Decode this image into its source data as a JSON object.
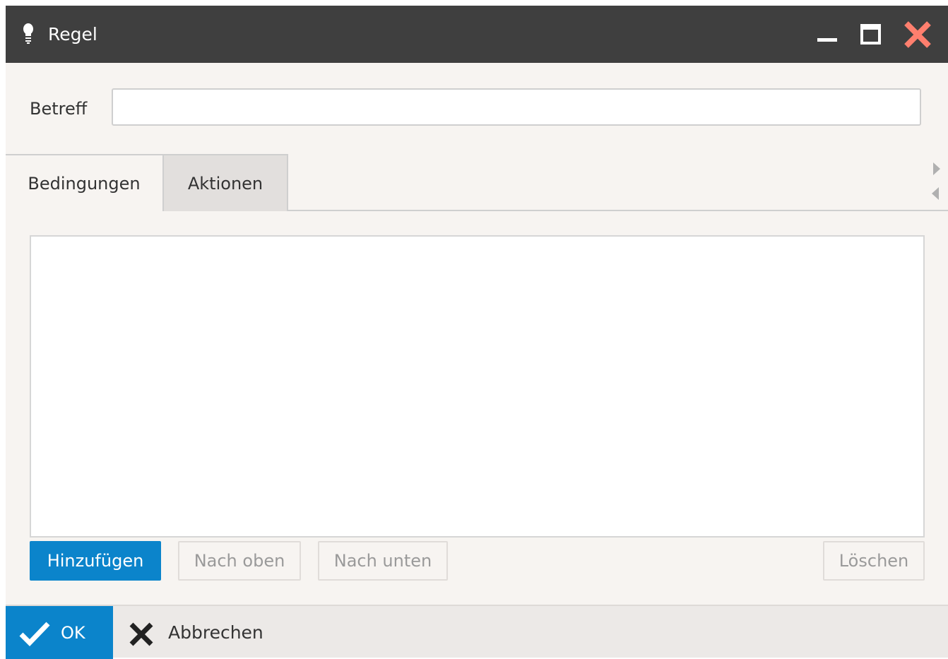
{
  "window": {
    "title": "Regel",
    "icon": "lightbulb-icon",
    "controls": [
      "minimize-icon",
      "maximize-icon",
      "close-icon"
    ],
    "close_color": "#ff7f6e"
  },
  "form": {
    "subject_label": "Betreff",
    "subject_value": ""
  },
  "tabs": [
    {
      "label": "Bedingungen",
      "active": true
    },
    {
      "label": "Aktionen",
      "active": false
    }
  ],
  "list": {
    "items": []
  },
  "list_actions": {
    "add_label": "Hinzufügen",
    "up_label": "Nach oben",
    "down_label": "Nach unten",
    "delete_label": "Löschen"
  },
  "footer": {
    "ok_label": "OK",
    "cancel_label": "Abbrechen"
  },
  "colors": {
    "accent": "#0b84cb",
    "titlebar": "#3f3f3f"
  }
}
